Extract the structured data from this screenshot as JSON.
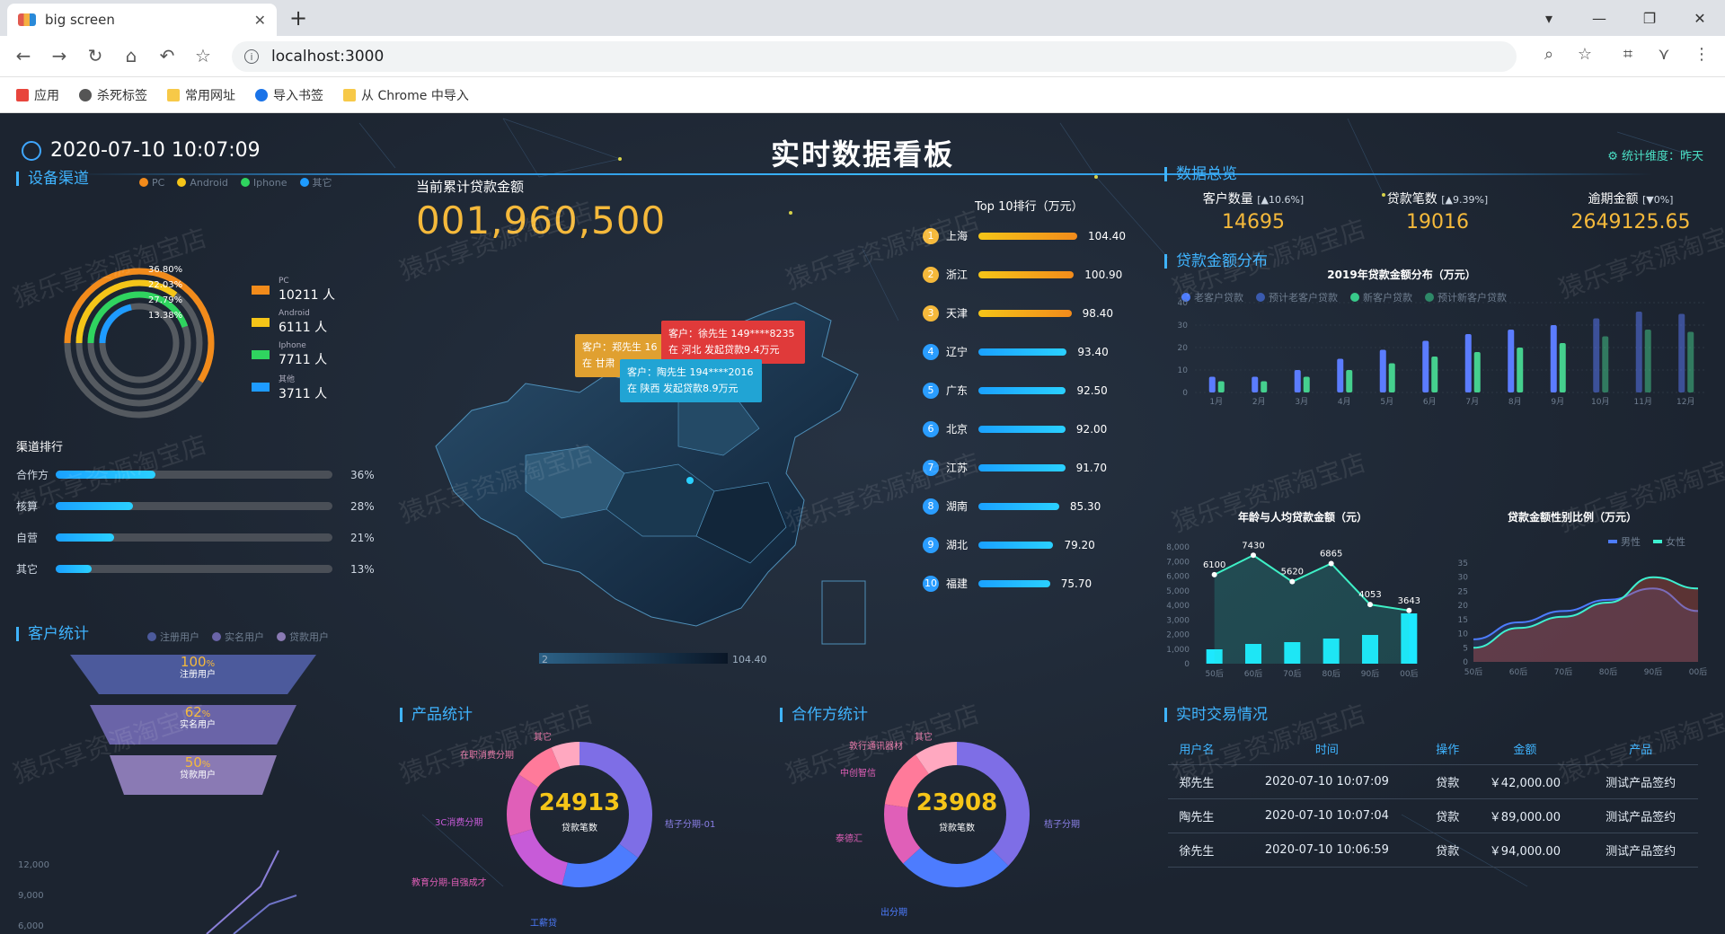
{
  "browser": {
    "tab_title": "big screen",
    "url": "localhost:3000",
    "bookmarks": [
      {
        "label": "应用",
        "color": "#e8453c"
      },
      {
        "label": "杀死标签",
        "color": "#555555"
      },
      {
        "label": "常用网址",
        "color": "#f7c948"
      },
      {
        "label": "导入书签",
        "color": "#1a73e8"
      },
      {
        "label": "从 Chrome 中导入",
        "color": "#f7c948"
      }
    ]
  },
  "header": {
    "datetime": "2020-07-10 10:07:09",
    "title": "实时数据看板",
    "dimension": "统计维度：昨天"
  },
  "device": {
    "title": "设备渠道",
    "legend": [
      {
        "name": "PC",
        "color": "#f28b1b"
      },
      {
        "name": "Android",
        "color": "#f5c518"
      },
      {
        "name": "Iphone",
        "color": "#2fd45f"
      },
      {
        "name": "其它",
        "color": "#1e9bff"
      }
    ],
    "percents": [
      "36.80%",
      "22.03%",
      "27.79%",
      "13.38%"
    ],
    "values": [
      36.8,
      22.03,
      27.79,
      13.38
    ],
    "items": [
      {
        "name": "PC",
        "count": "10211 人",
        "color": "#f28b1b"
      },
      {
        "name": "Android",
        "count": "6111 人",
        "color": "#f5c518"
      },
      {
        "name": "Iphone",
        "count": "7711 人",
        "color": "#2fd45f"
      },
      {
        "name": "其他",
        "count": "3711 人",
        "color": "#1e9bff"
      }
    ]
  },
  "channel": {
    "title": "渠道排行",
    "rows": [
      {
        "name": "合作方",
        "pct": "36%",
        "value": 36
      },
      {
        "name": "核算",
        "pct": "28%",
        "value": 28
      },
      {
        "name": "自营",
        "pct": "21%",
        "value": 21
      },
      {
        "name": "其它",
        "pct": "13%",
        "value": 13
      }
    ]
  },
  "customer": {
    "title": "客户统计",
    "legend": [
      "注册用户",
      "实名用户",
      "贷款用户"
    ],
    "funnel": [
      {
        "pct": "100",
        "unit": "%",
        "label": "注册用户"
      },
      {
        "pct": "62",
        "unit": "%",
        "label": "实名用户"
      },
      {
        "pct": "50",
        "unit": "%",
        "label": "贷款用户"
      }
    ],
    "axis": [
      "12,000",
      "9,000",
      "6,000"
    ]
  },
  "loan": {
    "title": "当前累计贷款金额",
    "amount": "001,960,500"
  },
  "map": {
    "range_min": "2",
    "range_max": "104.40",
    "tips": [
      {
        "text1": "客户：郑先生 16",
        "text2": "在 甘肃",
        "color": "#e0a030"
      },
      {
        "text1": "客户：徐先生 149****8235",
        "text2": "在 河北 发起贷款9.4万元",
        "color": "#e03a3a"
      },
      {
        "text1": "客户：陶先生 194****2016",
        "text2": "在 陕西 发起贷款8.9万元",
        "color": "#21a4d4"
      }
    ]
  },
  "top10": {
    "title": "Top 10排行（万元）",
    "rows": [
      {
        "no": "1",
        "name": "上海",
        "value": "104.40",
        "v": 104.4
      },
      {
        "no": "2",
        "name": "浙江",
        "value": "100.90",
        "v": 100.9
      },
      {
        "no": "3",
        "name": "天津",
        "value": "98.40",
        "v": 98.4
      },
      {
        "no": "4",
        "name": "辽宁",
        "value": "93.40",
        "v": 93.4
      },
      {
        "no": "5",
        "name": "广东",
        "value": "92.50",
        "v": 92.5
      },
      {
        "no": "6",
        "name": "北京",
        "value": "92.00",
        "v": 92.0
      },
      {
        "no": "7",
        "name": "江苏",
        "value": "91.70",
        "v": 91.7
      },
      {
        "no": "8",
        "name": "湖南",
        "value": "85.30",
        "v": 85.3
      },
      {
        "no": "9",
        "name": "湖北",
        "value": "79.20",
        "v": 79.2
      },
      {
        "no": "10",
        "name": "福建",
        "value": "75.70",
        "v": 75.7
      }
    ]
  },
  "overview": {
    "title": "数据总览",
    "stats": [
      {
        "label": "客户数量",
        "change": "[▲10.6%]",
        "value": "14695"
      },
      {
        "label": "贷款笔数",
        "change": "[▲9.39%]",
        "value": "19016"
      },
      {
        "label": "逾期金额",
        "change": "[▼0%]",
        "value": "2649125.65"
      }
    ]
  },
  "distribution": {
    "title": "贷款金额分布",
    "chart_title": "2019年贷款金额分布（万元）",
    "legend": [
      {
        "name": "老客户贷款",
        "color": "#4d7cfe"
      },
      {
        "name": "预计老客户贷款",
        "color": "#4d7cfe"
      },
      {
        "name": "新客户贷款",
        "color": "#38c98a"
      },
      {
        "name": "预计新客户贷款",
        "color": "#38c98a"
      }
    ],
    "yaxis": [
      "40",
      "30",
      "20",
      "10",
      "0"
    ]
  },
  "chart_data": [
    {
      "type": "bar",
      "title": "2019年贷款金额分布（万元）",
      "categories": [
        "1月",
        "2月",
        "3月",
        "4月",
        "5月",
        "6月",
        "7月",
        "8月",
        "9月",
        "10月",
        "11月",
        "12月"
      ],
      "series": [
        {
          "name": "老客户贷款",
          "values": [
            7,
            7,
            10,
            15,
            19,
            23,
            26,
            28,
            30,
            null,
            null,
            null
          ]
        },
        {
          "name": "预计老客户贷款",
          "values": [
            null,
            null,
            null,
            null,
            null,
            null,
            null,
            null,
            null,
            33,
            36,
            35
          ]
        },
        {
          "name": "新客户贷款",
          "values": [
            5,
            5,
            7,
            10,
            13,
            16,
            18,
            20,
            22,
            null,
            null,
            null
          ]
        },
        {
          "name": "预计新客户贷款",
          "values": [
            null,
            null,
            null,
            null,
            null,
            null,
            null,
            null,
            null,
            25,
            28,
            27
          ]
        }
      ],
      "ylim": [
        0,
        40
      ]
    },
    {
      "type": "line",
      "title": "年龄与人均贷款金额（元）",
      "categories": [
        "50后",
        "60后",
        "70后",
        "80后",
        "90后",
        "00后"
      ],
      "values": [
        6100,
        7430,
        5620,
        6865,
        4053,
        3643
      ],
      "yaxis": [
        "8,000",
        "7,000",
        "6,000",
        "5,000",
        "4,000",
        "3,000",
        "2,000",
        "1,000",
        "0"
      ],
      "ylim": [
        0,
        8000
      ]
    },
    {
      "type": "area",
      "title": "贷款金额性别比例（万元）",
      "categories": [
        "50后",
        "60后",
        "70后",
        "80后",
        "90后",
        "00后"
      ],
      "series": [
        {
          "name": "男性",
          "values": [
            8,
            14,
            18,
            22,
            26,
            18
          ]
        },
        {
          "name": "女性",
          "values": [
            5,
            12,
            16,
            21,
            30,
            26
          ]
        }
      ],
      "yaxis": [
        "35",
        "30",
        "25",
        "20",
        "15",
        "10",
        "5",
        "0"
      ],
      "ylim": [
        0,
        35
      ]
    }
  ],
  "product": {
    "title": "产品统计",
    "total": "24913",
    "sub": "贷款笔数",
    "labels": [
      "其它",
      "在职消费分期",
      "3C消费分期",
      "教育分期-自强成才",
      "工薪贷",
      "桔子分期-01"
    ]
  },
  "partner": {
    "title": "合作方统计",
    "total": "23908",
    "sub": "贷款笔数",
    "labels": [
      "其它",
      "敦行通讯器材",
      "中创智信",
      "泰德汇",
      "桔子分期",
      "出分期"
    ]
  },
  "trade": {
    "title": "实时交易情况",
    "headers": [
      "用户名",
      "时间",
      "操作",
      "金额",
      "产品"
    ],
    "rows": [
      [
        "郑先生",
        "2020-07-10 10:07:09",
        "贷款",
        "￥42,000.00",
        "测试产品签约"
      ],
      [
        "陶先生",
        "2020-07-10 10:07:04",
        "贷款",
        "￥89,000.00",
        "测试产品签约"
      ],
      [
        "徐先生",
        "2020-07-10 10:06:59",
        "贷款",
        "￥94,000.00",
        "测试产品签约"
      ]
    ]
  },
  "watermark": "猿乐享资源淘宝店"
}
